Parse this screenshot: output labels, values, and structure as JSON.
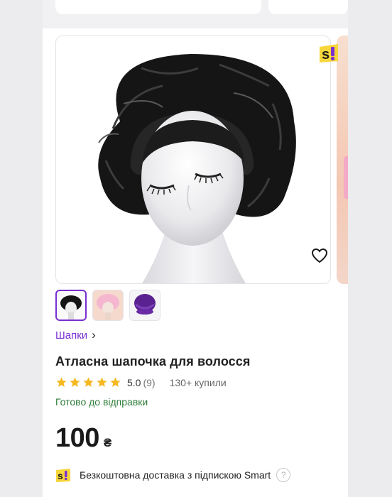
{
  "product": {
    "badge_icon": "smart-badge-icon",
    "favorite_icon": "heart-icon",
    "breadcrumb": "Шапки",
    "breadcrumb_chevron": "›",
    "title": "Атласна шапочка для волосся",
    "rating": "5.0",
    "reviews": "(9)",
    "rating_out_of": 5,
    "sold": "130+ купили",
    "availability": "Готово до відправки",
    "price": "100",
    "currency": "₴",
    "thumbnails": [
      {
        "name": "black-bonnet",
        "selected": true
      },
      {
        "name": "pink-bonnet",
        "selected": false
      },
      {
        "name": "purple-bonnet",
        "selected": false
      }
    ]
  },
  "delivery": {
    "text": "Безкоштовна доставка з підпискою Smart",
    "help": "?"
  },
  "colors": {
    "accent": "#7a2fd1",
    "badge_yellow": "#f7d63b",
    "star": "#f5b820",
    "availability": "#2f7d3a"
  }
}
